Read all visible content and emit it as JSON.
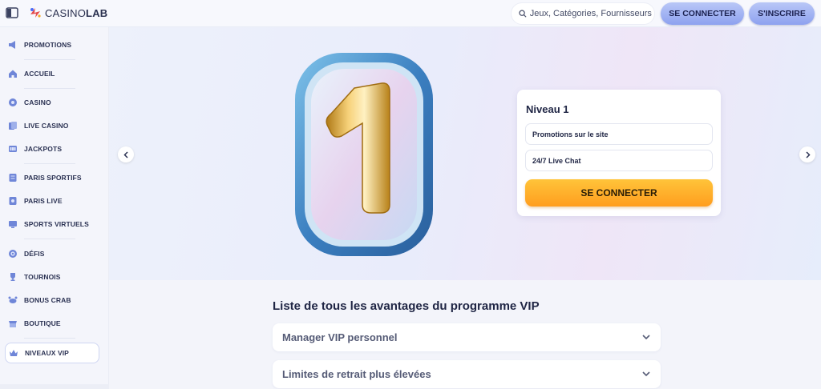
{
  "header": {
    "logo_text_a": "CASINO",
    "logo_text_b": "LAB",
    "search_placeholder": "Jeux, Catégories, Fournisseurs",
    "login_label": "SE CONNECTER",
    "register_label": "S'INSCRIRE",
    "accent_color": "#8ea2ef"
  },
  "sidebar": {
    "items": [
      {
        "label": "PROMOTIONS",
        "icon": "megaphone-icon"
      },
      {
        "label": "ACCUEIL",
        "icon": "home-icon"
      },
      {
        "label": "CASINO",
        "icon": "casino-chip-icon"
      },
      {
        "label": "LIVE CASINO",
        "icon": "live-cards-icon"
      },
      {
        "label": "JACKPOTS",
        "icon": "jackpot-icon"
      },
      {
        "label": "PARIS SPORTIFS",
        "icon": "sports-ticket-icon"
      },
      {
        "label": "PARIS LIVE",
        "icon": "live-bet-icon"
      },
      {
        "label": "SPORTS VIRTUELS",
        "icon": "virtual-sports-icon"
      },
      {
        "label": "DÉFIS",
        "icon": "challenge-icon"
      },
      {
        "label": "TOURNOIS",
        "icon": "trophy-icon"
      },
      {
        "label": "BONUS CRAB",
        "icon": "crab-icon"
      },
      {
        "label": "BOUTIQUE",
        "icon": "shop-icon"
      },
      {
        "label": "NIVEAUX VIP",
        "icon": "crown-icon",
        "active": true
      }
    ]
  },
  "hero": {
    "badge_level": "1",
    "card": {
      "title": "Niveau 1",
      "perks": [
        "Promotions sur le site",
        "24/7 Live Chat"
      ],
      "cta_label": "SE CONNECTER",
      "cta_color": "#ffae2a"
    }
  },
  "vip_section": {
    "title": "Liste de tous les avantages du programme VIP",
    "accordion": [
      "Manager VIP personnel",
      "Limites de retrait plus élevées"
    ]
  }
}
